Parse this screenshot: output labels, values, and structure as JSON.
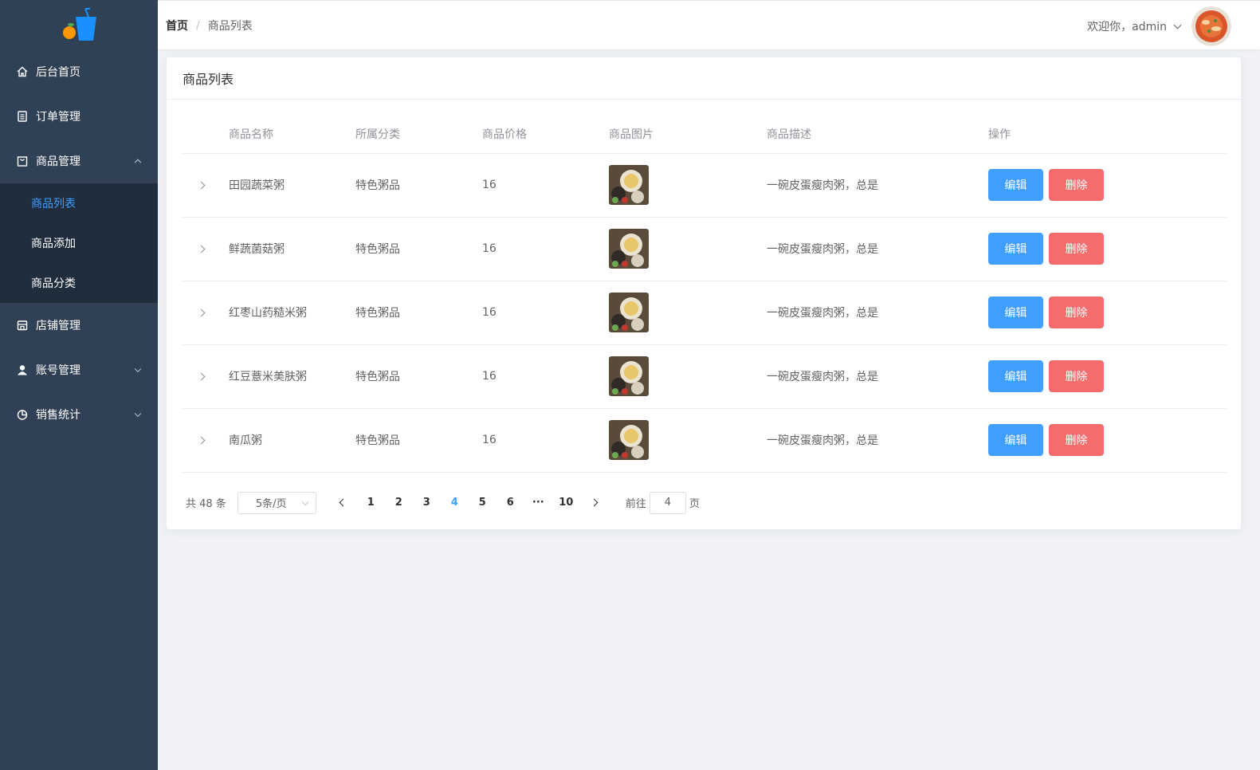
{
  "sidebar": {
    "items": [
      {
        "label": "后台首页",
        "icon": "home-icon"
      },
      {
        "label": "订单管理",
        "icon": "document-icon"
      },
      {
        "label": "商品管理",
        "icon": "goods-icon",
        "expanded": true,
        "children": [
          {
            "label": "商品列表",
            "active": true
          },
          {
            "label": "商品添加"
          },
          {
            "label": "商品分类"
          }
        ]
      },
      {
        "label": "店铺管理",
        "icon": "shop-icon"
      },
      {
        "label": "账号管理",
        "icon": "user-icon"
      },
      {
        "label": "销售统计",
        "icon": "pie-chart-icon"
      }
    ]
  },
  "header": {
    "breadcrumb": {
      "home": "首页",
      "separator": "/",
      "current": "商品列表"
    },
    "welcome": "欢迎你，admin"
  },
  "card": {
    "title": "商品列表",
    "columns": [
      "商品名称",
      "所属分类",
      "商品价格",
      "商品图片",
      "商品描述",
      "操作"
    ],
    "rows": [
      {
        "name": "田园蔬菜粥",
        "category": "特色粥品",
        "price": "16",
        "desc": "一碗皮蛋瘦肉粥，总是"
      },
      {
        "name": "鲜蔬菌菇粥",
        "category": "特色粥品",
        "price": "16",
        "desc": "一碗皮蛋瘦肉粥，总是"
      },
      {
        "name": "红枣山药糙米粥",
        "category": "特色粥品",
        "price": "16",
        "desc": "一碗皮蛋瘦肉粥，总是"
      },
      {
        "name": "红豆薏米美肤粥",
        "category": "特色粥品",
        "price": "16",
        "desc": "一碗皮蛋瘦肉粥，总是"
      },
      {
        "name": "南瓜粥",
        "category": "特色粥品",
        "price": "16",
        "desc": "一碗皮蛋瘦肉粥，总是"
      }
    ],
    "edit_label": "编辑",
    "delete_label": "删除"
  },
  "pagination": {
    "total": "共 48 条",
    "page_size": "5条/页",
    "pages": [
      "1",
      "2",
      "3",
      "4",
      "5",
      "6",
      "···",
      "10"
    ],
    "current": "4",
    "goto_prefix": "前往",
    "goto_value": "4",
    "goto_suffix": "页"
  },
  "colors": {
    "sidebar_bg": "#304156",
    "submenu_bg": "#1f2d3d",
    "primary": "#409eff",
    "danger": "#f56c6c"
  }
}
